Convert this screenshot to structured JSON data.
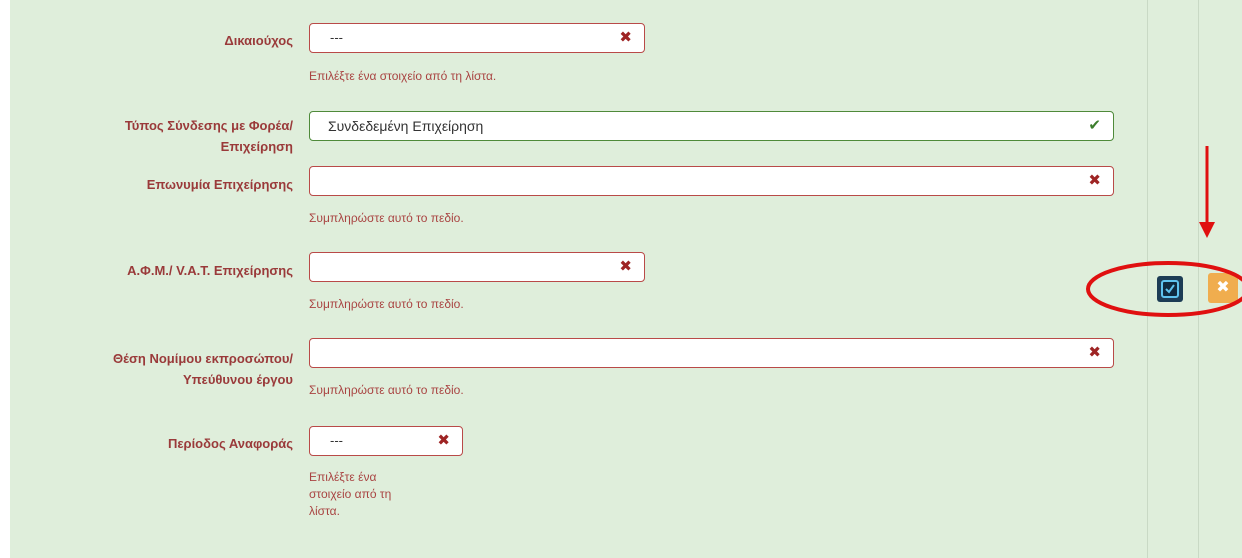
{
  "form": {
    "fields": [
      {
        "label": "Δικαιούχος",
        "value": "---",
        "status": "invalid",
        "help": "Επιλέξτε ένα στοιχείο από τη λίστα."
      },
      {
        "label_line1": "Τύπος Σύνδεσης με Φορέα/",
        "label_line2": "Επιχείρηση",
        "value": "Συνδεδεμένη Επιχείρηση",
        "status": "valid"
      },
      {
        "label": "Επωνυμία Επιχείρησης",
        "value": "",
        "status": "invalid",
        "help": "Συμπληρώστε αυτό το πεδίο."
      },
      {
        "label": "Α.Φ.Μ./ V.A.T. Επιχείρησης",
        "value": "",
        "status": "invalid",
        "help": "Συμπληρώστε αυτό το πεδίο."
      },
      {
        "label_line1": "Θέση Νομίμου εκπροσώπου/",
        "label_line2": "Υπεύθυνου έργου",
        "value": "",
        "status": "invalid",
        "help": "Συμπληρώστε αυτό το πεδίο."
      },
      {
        "label": "Περίοδος Αναφοράς",
        "value": "---",
        "status": "invalid",
        "help_lines": [
          "Επιλέξτε ένα",
          "στοιχείο από τη",
          "λίστα."
        ]
      }
    ]
  },
  "row_actions": {
    "edit": "edit-icon",
    "delete": "close-icon"
  },
  "icons": {
    "invalid": "✖",
    "valid": "✔",
    "delete": "✖"
  },
  "colors": {
    "error": "#a94442",
    "valid": "#3c7d2c",
    "panel": "#dfeedb",
    "annotation": "#e01010"
  }
}
